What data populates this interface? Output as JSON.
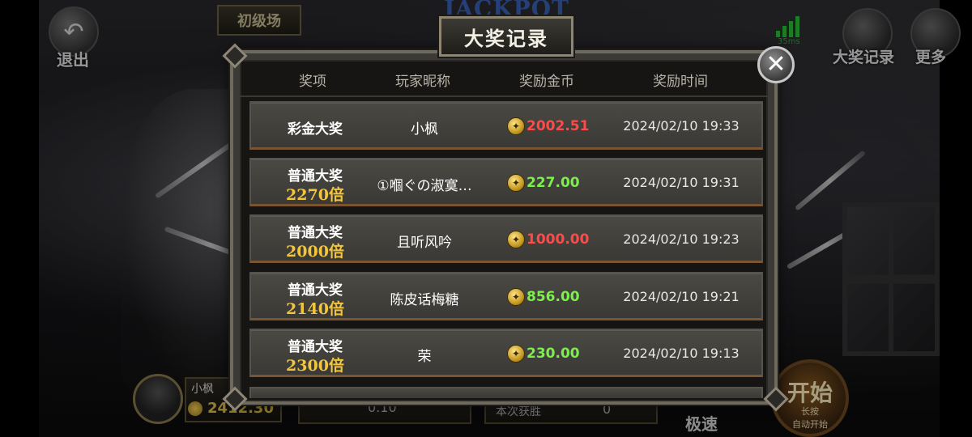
{
  "app": {
    "exit_label": "退出",
    "level_tag": "初级场",
    "jackpot_banner": "JACKPOT",
    "ping": "35ms",
    "top_right": {
      "jackpot_record_label": "大奖记录",
      "more_label": "更多"
    },
    "player": {
      "name": "小枫",
      "balance": "2412.30"
    },
    "bottom": {
      "bet_display": "0.10",
      "win_label": "本次获胜",
      "win_value": "0",
      "speed_label": "极速"
    },
    "start_button": {
      "main": "开始",
      "sub1": "长按",
      "sub2": "自动开始"
    }
  },
  "modal": {
    "title": "大奖记录",
    "close_symbol": "✕",
    "columns": [
      "奖项",
      "玩家昵称",
      "奖励金币",
      "奖励时间"
    ],
    "rows": [
      {
        "type": "彩金大奖",
        "multiplier": "",
        "player": "小枫",
        "amount": "2002.51",
        "amount_color": "#ff4a4a",
        "time": "2024/02/10 19:33"
      },
      {
        "type": "普通大奖",
        "multiplier": "2270倍",
        "player": "①嗰ぐの淑寞…",
        "amount": "227.00",
        "amount_color": "#7cf04a",
        "time": "2024/02/10 19:31"
      },
      {
        "type": "普通大奖",
        "multiplier": "2000倍",
        "player": "且听风吟",
        "amount": "1000.00",
        "amount_color": "#ff4a4a",
        "time": "2024/02/10 19:23"
      },
      {
        "type": "普通大奖",
        "multiplier": "2140倍",
        "player": "陈皮话梅糖",
        "amount": "856.00",
        "amount_color": "#7cf04a",
        "time": "2024/02/10 19:21"
      },
      {
        "type": "普通大奖",
        "multiplier": "2300倍",
        "player": "荣",
        "amount": "230.00",
        "amount_color": "#7cf04a",
        "time": "2024/02/10 19:13"
      }
    ]
  }
}
